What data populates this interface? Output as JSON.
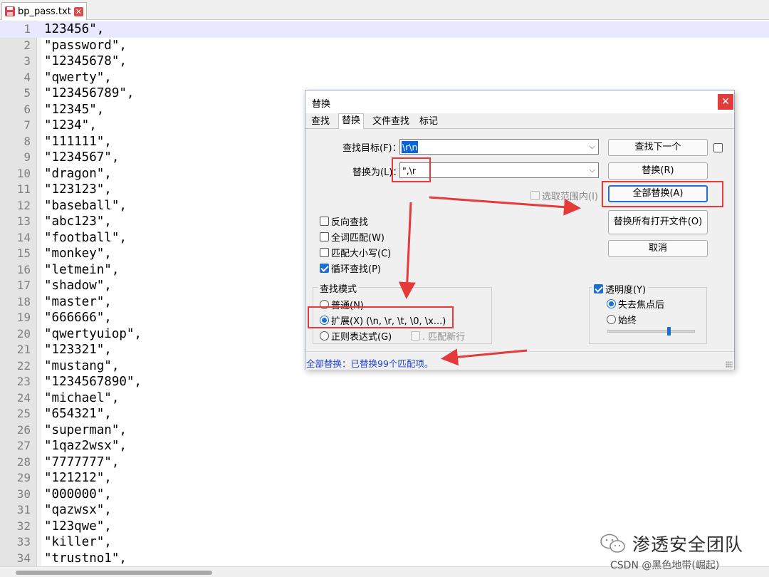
{
  "tab": {
    "filename": "bp_pass.txt",
    "close_glyph": "✕",
    "icon": "save-icon"
  },
  "editor": {
    "lines": [
      {
        "num": "1",
        "text": "123456\","
      },
      {
        "num": "2",
        "text": "\"password\","
      },
      {
        "num": "3",
        "text": "\"12345678\","
      },
      {
        "num": "4",
        "text": "\"qwerty\","
      },
      {
        "num": "5",
        "text": "\"123456789\","
      },
      {
        "num": "6",
        "text": "\"12345\","
      },
      {
        "num": "7",
        "text": "\"1234\","
      },
      {
        "num": "8",
        "text": "\"111111\","
      },
      {
        "num": "9",
        "text": "\"1234567\","
      },
      {
        "num": "10",
        "text": "\"dragon\","
      },
      {
        "num": "11",
        "text": "\"123123\","
      },
      {
        "num": "12",
        "text": "\"baseball\","
      },
      {
        "num": "13",
        "text": "\"abc123\","
      },
      {
        "num": "14",
        "text": "\"football\","
      },
      {
        "num": "15",
        "text": "\"monkey\","
      },
      {
        "num": "16",
        "text": "\"letmein\","
      },
      {
        "num": "17",
        "text": "\"shadow\","
      },
      {
        "num": "18",
        "text": "\"master\","
      },
      {
        "num": "19",
        "text": "\"666666\","
      },
      {
        "num": "20",
        "text": "\"qwertyuiop\","
      },
      {
        "num": "21",
        "text": "\"123321\","
      },
      {
        "num": "22",
        "text": "\"mustang\","
      },
      {
        "num": "23",
        "text": "\"1234567890\","
      },
      {
        "num": "24",
        "text": "\"michael\","
      },
      {
        "num": "25",
        "text": "\"654321\","
      },
      {
        "num": "26",
        "text": "\"superman\","
      },
      {
        "num": "27",
        "text": "\"1qaz2wsx\","
      },
      {
        "num": "28",
        "text": "\"7777777\","
      },
      {
        "num": "29",
        "text": "\"121212\","
      },
      {
        "num": "30",
        "text": "\"000000\","
      },
      {
        "num": "31",
        "text": "\"qazwsx\","
      },
      {
        "num": "32",
        "text": "\"123qwe\","
      },
      {
        "num": "33",
        "text": "\"killer\","
      },
      {
        "num": "34",
        "text": "\"trustno1\","
      }
    ]
  },
  "dialog": {
    "title": "替换",
    "close_glyph": "✕",
    "tabs": [
      "查找",
      "替换",
      "文件查找",
      "标记"
    ],
    "active_tab": "替换",
    "find_label": "查找目标(F)：",
    "find_value": "\\r\\n",
    "replace_label": "替换为(L)：",
    "replace_value": "\",\\r",
    "buttons": {
      "find_next": "查找下一个",
      "replace": "替换(R)",
      "replace_all": "全部替换(A)",
      "replace_all_open": "替换所有打开文件(O)",
      "cancel": "取消"
    },
    "in_selection": "选取范围内(I)",
    "options": [
      {
        "label": "反向查找",
        "checked": false
      },
      {
        "label": "全词匹配(W)",
        "checked": false
      },
      {
        "label": "匹配大小写(C)",
        "checked": false
      },
      {
        "label": "循环查找(P)",
        "checked": true
      }
    ],
    "search_mode": {
      "title": "查找模式",
      "normal": "普通(N)",
      "extended": "扩展(X) (\\n, \\r, \\t, \\0, \\x...)",
      "regex": "正则表达式(G)",
      "dot_newline": ". 匹配新行",
      "selected": "extended"
    },
    "transparency": {
      "label": "透明度(Y)",
      "checked": true,
      "on_lose_focus": "失去焦点后",
      "always": "始终",
      "selected": "on_lose_focus",
      "level": 0.7
    },
    "status": "全部替换：已替换99个匹配项。"
  },
  "watermark": {
    "main": "渗透安全团队",
    "sub": "CSDN @黑色地带(崛起)"
  },
  "colors": {
    "annotation_red": "#e53a3a",
    "status_blue": "#1f3fd8",
    "accent": "#1a6fd1"
  }
}
